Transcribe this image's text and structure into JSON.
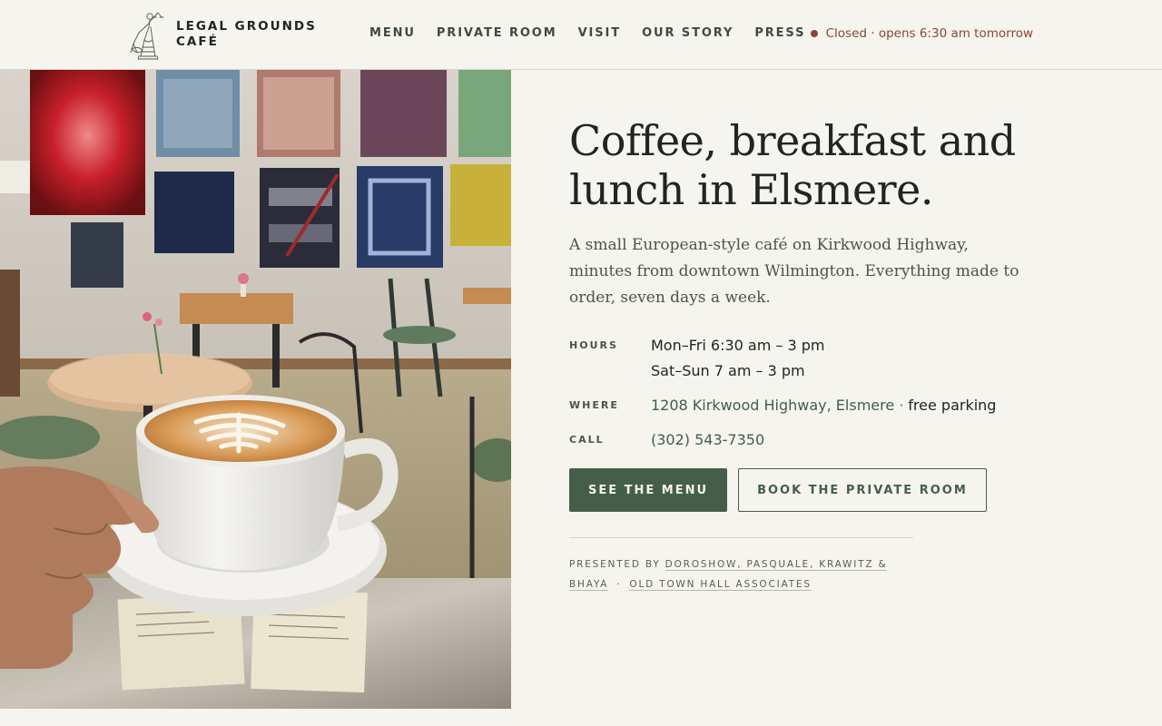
{
  "brand": {
    "name_line1": "Legal Grounds",
    "name_line2": "Café",
    "logo_icon": "lady-justice-icon"
  },
  "nav": {
    "items": [
      {
        "label": "Menu"
      },
      {
        "label": "Private Room"
      },
      {
        "label": "Visit"
      },
      {
        "label": "Our Story"
      },
      {
        "label": "Press"
      }
    ]
  },
  "status": {
    "text": "Closed · opens 6:30 am tomorrow",
    "color": "#8a4634",
    "icon": "status-dot-icon"
  },
  "hero": {
    "photo_alt": "",
    "title_line1": "Coffee, breakfast and",
    "title_line2": "lunch in Elsmere.",
    "lede": "A small European-style café on Kirkwood Highway, minutes from downtown Wilmington. Everything made to order, seven days a week."
  },
  "info": {
    "hours_label": "Hours",
    "hours_line1": "Mon–Fri 6:30 am – 3 pm",
    "hours_line2": "Sat–Sun 7 am – 3 pm",
    "where_label": "Where",
    "address": "1208 Kirkwood Highway, Elsmere",
    "separator": "·",
    "parking": "free parking",
    "call_label": "Call",
    "phone": "(302) 543-7350"
  },
  "actions": {
    "menu_button": "See the Menu",
    "private_room_button": "Book the Private Room"
  },
  "presented": {
    "prefix": "Presented by",
    "sponsor1": "Doroshow, Pasquale, Krawitz & Bhaya",
    "separator": "·",
    "sponsor2": "Old Town Hall Associates"
  },
  "colors": {
    "background": "#f6f4ee",
    "accent_green": "#455e49",
    "link_green": "#3f6048",
    "status_red": "#8a4634",
    "text": "#23241f"
  }
}
